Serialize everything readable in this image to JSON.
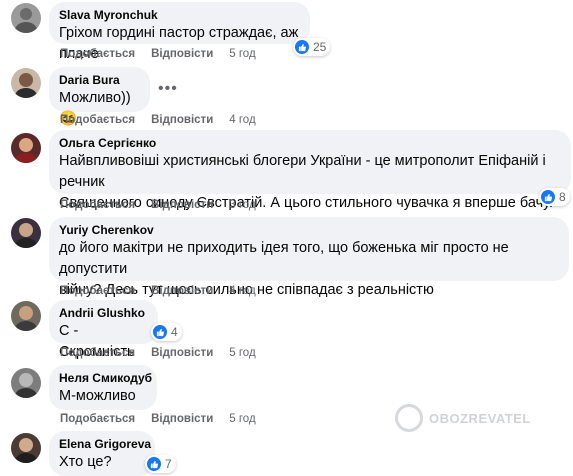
{
  "comments": [
    {
      "author": "Slava Myronchuk",
      "text": "Гріхом гордині пастор страждає, аж плаче",
      "like_label": "Подобається",
      "reply_label": "Відповісти",
      "time": "5 год",
      "reactions": "25"
    },
    {
      "author": "Daria Bura",
      "text": "Можливо))",
      "like_label": "Подобається",
      "reply_label": "Відповісти",
      "time": "4 год",
      "emoji": "😆"
    },
    {
      "author": "Ольга Сергієнко",
      "text_lines": [
        "Найвпливовіші християнські блогери України - це митрополит Епіфаній і речник",
        "Священного синоду Євстратій. А цього стильного чувачка я вперше бачу."
      ],
      "like_label": "Подобається",
      "reply_label": "Відповісти",
      "time": "3 год",
      "reactions": "8"
    },
    {
      "author": "Yuriy Cherenkov",
      "text_lines": [
        "до його макітри не приходить ідея того, що боженька міг просто не допустити",
        "війну? Десь тут щось сильно не співпадає з реальністю"
      ],
      "like_label": "Подобається",
      "reply_label": "Відповісти",
      "time": "4 год"
    },
    {
      "author": "Andrii Glushko",
      "text": "С - Скромність",
      "like_label": "Подобається",
      "reply_label": "Відповісти",
      "time": "5 год",
      "reactions": "4"
    },
    {
      "author": "Неля Смикодуб",
      "text": "М-можливо",
      "like_label": "Подобається",
      "reply_label": "Відповісти",
      "time": "5 год"
    },
    {
      "author": "Elena Grigoreva",
      "text": "Хто це?",
      "reactions": "7"
    }
  ],
  "watermark": "OBOZREVATEL",
  "colors": {
    "bubble": "#f0f2f5",
    "meta": "#65676b",
    "like": "#1877f2"
  }
}
